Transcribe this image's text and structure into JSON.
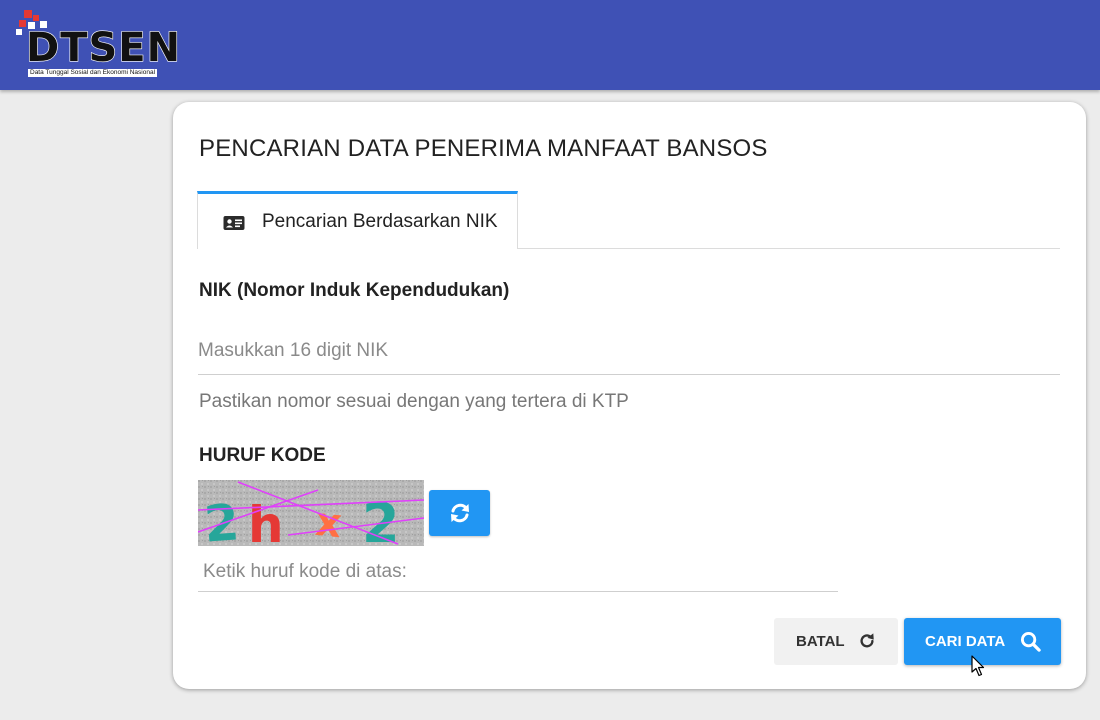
{
  "header": {
    "logo_text": "DTSEN",
    "logo_subtitle": "Data Tunggal Sosial dan Ekonomi Nasional",
    "bar_color": "#3f51b5"
  },
  "card": {
    "title": "PENCARIAN DATA PENERIMA MANFAAT BANSOS",
    "tab": {
      "label": "Pencarian Berdasarkan NIK",
      "icon": "id-card-icon"
    },
    "nik": {
      "label": "NIK (Nomor Induk Kependudukan)",
      "value": "",
      "placeholder": "Masukkan 16 digit NIK",
      "helper": "Pastikan nomor sesuai dengan yang tertera di KTP"
    },
    "captcha": {
      "label": "HURUF KODE",
      "code": "2hx2",
      "value": "",
      "placeholder": "Ketik huruf kode di atas:",
      "refresh_icon": "refresh-icon"
    },
    "buttons": {
      "cancel_label": "BATAL",
      "cancel_icon": "redo-icon",
      "search_label": "CARI DATA",
      "search_icon": "search-icon"
    }
  },
  "colors": {
    "primary": "#2196f3",
    "header": "#3f51b5",
    "background": "#ececec"
  }
}
